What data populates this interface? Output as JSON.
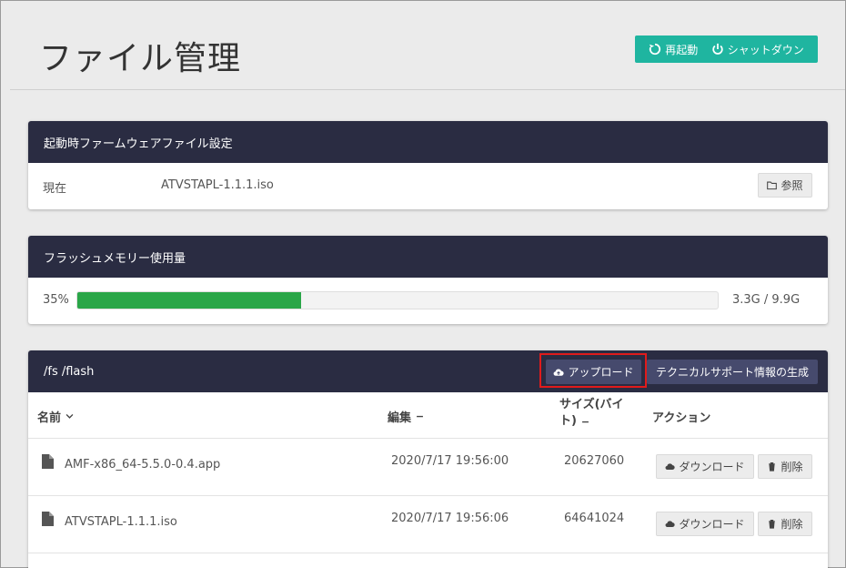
{
  "page": {
    "title": "ファイル管理"
  },
  "top_actions": {
    "restart": "再起動",
    "shutdown": "シャットダウン"
  },
  "boot_firmware": {
    "header": "起動時ファームウェアファイル設定",
    "current_label": "現在",
    "current_value": "ATVSTAPL-1.1.1.iso",
    "browse": "参照"
  },
  "flash_usage": {
    "header": "フラッシュメモリー使用量",
    "percent_label": "35%",
    "percent": 35,
    "usage": "3.3G / 9.9G"
  },
  "file_list": {
    "path": "/fs /flash",
    "upload": "アップロード",
    "support": "テクニカルサポート情報の生成",
    "columns": {
      "name": "名前",
      "edit": "編集",
      "size_line1": "サイズ(バイ",
      "size_line2": "ト)",
      "action": "アクション"
    },
    "rows": [
      {
        "name": "AMF-x86_64-5.5.0-0.4.app",
        "date": "2020/7/17 19:56:00",
        "size": "20627060",
        "download": "ダウンロード",
        "delete": "削除"
      },
      {
        "name": "ATVSTAPL-1.1.1.iso",
        "date": "2020/7/17 19:56:06",
        "size": "64641024",
        "download": "ダウンロード",
        "delete": "削除"
      }
    ]
  },
  "colors": {
    "accent": "#1fb5a0",
    "header": "#2a2c42",
    "progress": "#2aa648",
    "highlight": "#e01b1b"
  }
}
